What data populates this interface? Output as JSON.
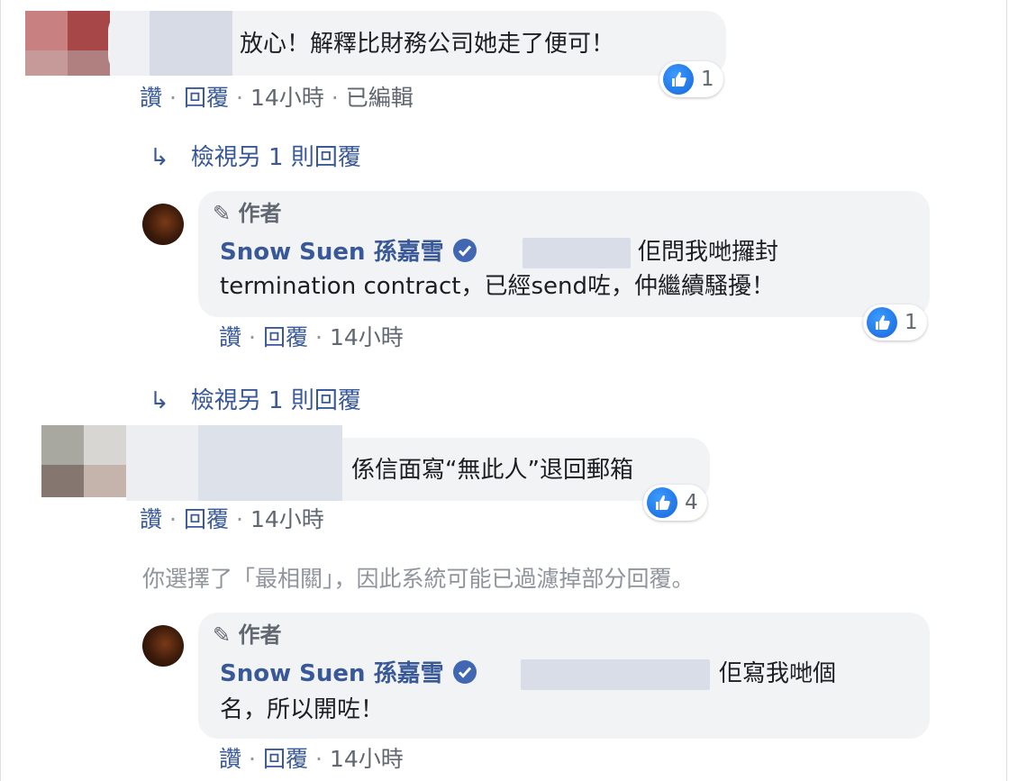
{
  "comments": [
    {
      "text": "放心！解釋比財務公司她走了便可！",
      "reaction_count": "1",
      "actions": {
        "like": "讚",
        "reply": "回覆",
        "time": "14小時",
        "edited": "已編輯"
      }
    },
    {
      "text": "係信面寫“無此人”退回郵箱",
      "reaction_count": "4",
      "actions": {
        "like": "讚",
        "reply": "回覆",
        "time": "14小時"
      }
    }
  ],
  "view_more_replies": [
    "檢視另 1 則回覆",
    "檢視另 1 則回覆"
  ],
  "author_replies": [
    {
      "author_tag": "作者",
      "name": "Snow Suen 孫嘉雪",
      "line1": "佢問我哋攞封",
      "line2": "termination contract，已經send咗，仲繼續騷擾！",
      "reaction_count": "1",
      "actions": {
        "like": "讚",
        "reply": "回覆",
        "time": "14小時"
      }
    },
    {
      "author_tag": "作者",
      "name": "Snow Suen 孫嘉雪",
      "line1": "佢寫我哋個",
      "line2": "名，所以開咗！",
      "actions": {
        "like": "讚",
        "reply": "回覆",
        "time": "14小時"
      }
    }
  ],
  "filter_note": "你選擇了「最相關」，因此系統可能已過濾掉部分回覆。",
  "icons": {
    "like": "like-thumb-icon",
    "verified": "verified-check-icon",
    "reply_arrow": "reply-arrow-icon",
    "author": "pencil-icon"
  },
  "colors": {
    "link": "#385898",
    "like_blue": "#1877f2",
    "bubble": "#f2f3f5",
    "muted": "#90949c"
  }
}
